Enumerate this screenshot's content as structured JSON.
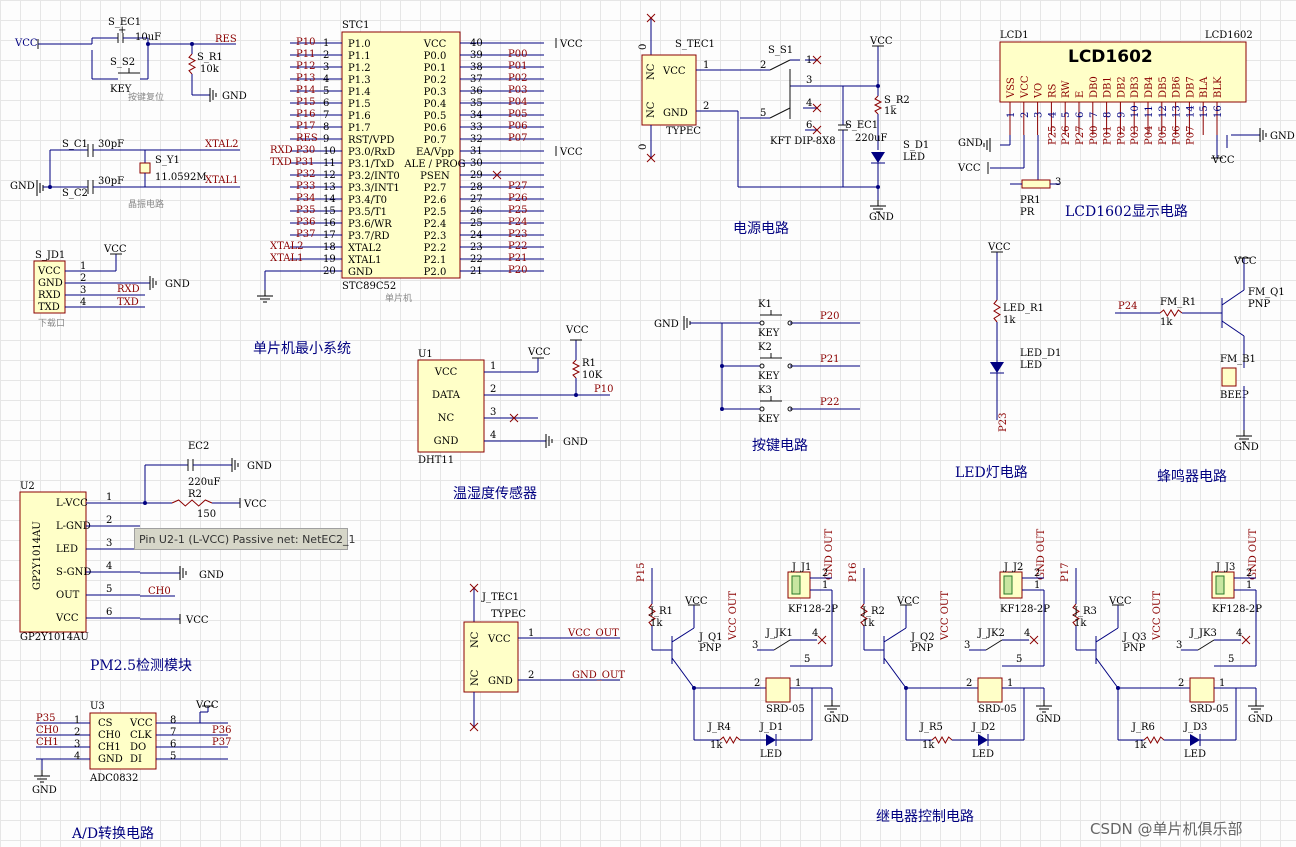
{
  "sections": {
    "mcu_min": "单片机最小系统",
    "power": "电源电路",
    "lcd": "LCD1602显示电路",
    "dht": "温湿度传感器",
    "keys": "按键电路",
    "led": "LED灯电路",
    "buzzer": "蜂鸣器电路",
    "pm25": "PM2.5检测模块",
    "relay": "继电器控制电路",
    "adc": "A/D转换电路"
  },
  "mcu": {
    "ref": "STC1",
    "part": "STC89C52",
    "cn": "单片机",
    "left_pins": [
      {
        "n": "1",
        "name": "P1.0",
        "net": "P10"
      },
      {
        "n": "2",
        "name": "P1.1",
        "net": "P11"
      },
      {
        "n": "3",
        "name": "P1.2",
        "net": "P12"
      },
      {
        "n": "4",
        "name": "P1.3",
        "net": "P13"
      },
      {
        "n": "5",
        "name": "P1.4",
        "net": "P14"
      },
      {
        "n": "6",
        "name": "P1.5",
        "net": "P15"
      },
      {
        "n": "7",
        "name": "P1.6",
        "net": "P16"
      },
      {
        "n": "8",
        "name": "P1.7",
        "net": "P17"
      },
      {
        "n": "9",
        "name": "RST/VPD",
        "net": "RES"
      },
      {
        "n": "10",
        "name": "P3.0/RxD",
        "net": "RXD P30"
      },
      {
        "n": "11",
        "name": "P3.1/TxD",
        "net": "TXD P31"
      },
      {
        "n": "12",
        "name": "P3.2/INT0",
        "net": "P32"
      },
      {
        "n": "13",
        "name": "P3.3/INT1",
        "net": "P33"
      },
      {
        "n": "14",
        "name": "P3.4/T0",
        "net": "P34"
      },
      {
        "n": "15",
        "name": "P3.5/T1",
        "net": "P35"
      },
      {
        "n": "16",
        "name": "P3.6/WR",
        "net": "P36"
      },
      {
        "n": "17",
        "name": "P3.7/RD",
        "net": "P37"
      },
      {
        "n": "18",
        "name": "XTAL2",
        "net": "XTAL2"
      },
      {
        "n": "19",
        "name": "XTAL1",
        "net": "XTAL1"
      },
      {
        "n": "20",
        "name": "GND",
        "net": ""
      }
    ],
    "right_pins": [
      {
        "n": "40",
        "name": "VCC",
        "net": "VCC"
      },
      {
        "n": "39",
        "name": "P0.0",
        "net": "P00"
      },
      {
        "n": "38",
        "name": "P0.1",
        "net": "P01"
      },
      {
        "n": "37",
        "name": "P0.2",
        "net": "P02"
      },
      {
        "n": "36",
        "name": "P0.3",
        "net": "P03"
      },
      {
        "n": "35",
        "name": "P0.4",
        "net": "P04"
      },
      {
        "n": "34",
        "name": "P0.5",
        "net": "P05"
      },
      {
        "n": "33",
        "name": "P0.6",
        "net": "P06"
      },
      {
        "n": "32",
        "name": "P0.7",
        "net": "P07"
      },
      {
        "n": "31",
        "name": "EA/Vpp",
        "net": "VCC"
      },
      {
        "n": "30",
        "name": "ALE / PROG",
        "net": ""
      },
      {
        "n": "29",
        "name": "PSEN",
        "net": ""
      },
      {
        "n": "28",
        "name": "P2.7",
        "net": "P27"
      },
      {
        "n": "27",
        "name": "P2.6",
        "net": "P26"
      },
      {
        "n": "26",
        "name": "P2.5",
        "net": "P25"
      },
      {
        "n": "25",
        "name": "P2.4",
        "net": "P24"
      },
      {
        "n": "24",
        "name": "P2.3",
        "net": "P23"
      },
      {
        "n": "23",
        "name": "P2.2",
        "net": "P22"
      },
      {
        "n": "22",
        "name": "P2.1",
        "net": "P21"
      },
      {
        "n": "21",
        "name": "P2.0",
        "net": "P20"
      }
    ]
  },
  "reset": {
    "ec": "S_EC1",
    "ec_val": "10uF",
    "sw": "S_S2",
    "sw_val": "KEY",
    "r": "S_R1",
    "r_val": "10k",
    "net_res": "RES",
    "cap": "按键复位",
    "vcc": "VCC",
    "gnd": "GND"
  },
  "crystal": {
    "c1": "S_C1",
    "c2": "S_C2",
    "cval": "30pF",
    "y": "S_Y1",
    "yval": "11.0592M",
    "x2": "XTAL2",
    "x1": "XTAL1",
    "gnd": "GND",
    "cap": "晶振电路"
  },
  "download": {
    "ref": "S_JD1",
    "pins": [
      "VCC",
      "GND",
      "RXD",
      "TXD"
    ],
    "nums": [
      "1",
      "2",
      "3",
      "4"
    ],
    "vcc": "VCC",
    "gnd": "GND",
    "rxd": "RXD",
    "txd": "TXD",
    "cap": "下载口"
  },
  "power": {
    "ref": "S_TEC1",
    "part": "TYPEC",
    "nc": "NC",
    "vcc": "VCC",
    "gnd": "GND",
    "sw": "S_S1",
    "swpart": "KFT DIP-8X8",
    "ec": "S_EC1",
    "ecval": "220uF",
    "r": "S_R2",
    "rval": "1k",
    "led": "S_D1",
    "ledv": "LED",
    "gndn": "GND",
    "vccn": "VCC",
    "p1": "1",
    "p2": "2",
    "zero": "0",
    "s": [
      "1",
      "2",
      "3",
      "4",
      "5",
      "6"
    ]
  },
  "lcd": {
    "ref": "LCD1",
    "part": "LCD1602",
    "title": "LCD1602",
    "pins": [
      "VSS",
      "VCC",
      "VO",
      "RS",
      "RW",
      "E",
      "DB0",
      "DB1",
      "DB2",
      "DB3",
      "DB4",
      "DB5",
      "DB6",
      "DB7",
      "BLA",
      "BLK"
    ],
    "nums": [
      "1",
      "2",
      "3",
      "4",
      "5",
      "6",
      "7",
      "8",
      "9",
      "10",
      "11",
      "12",
      "13",
      "14",
      "15",
      "16"
    ],
    "nets": [
      "",
      "",
      "",
      "P25",
      "P26",
      "P27",
      "P00",
      "P01",
      "P02",
      "P03",
      "P04",
      "P05",
      "P06",
      "P07",
      "",
      ""
    ],
    "pr": "PR1",
    "prv": "PR",
    "gnd": "GND",
    "vcc": "VCC",
    "p3": "3"
  },
  "dht": {
    "ref": "U1",
    "part": "DHT11",
    "pins": [
      "VCC",
      "DATA",
      "NC",
      "GND"
    ],
    "nums": [
      "1",
      "2",
      "3",
      "4"
    ],
    "r": "R1",
    "rval": "10K",
    "net": "P10",
    "vcc": "VCC",
    "gnd": "GND"
  },
  "keys": {
    "gnd": "GND",
    "items": [
      {
        "ref": "K1",
        "val": "KEY",
        "net": "P20"
      },
      {
        "ref": "K2",
        "val": "KEY",
        "net": "P21"
      },
      {
        "ref": "K3",
        "val": "KEY",
        "net": "P22"
      }
    ]
  },
  "led": {
    "vcc": "VCC",
    "r": "LED_R1",
    "rval": "1k",
    "d": "LED_D1",
    "dv": "LED",
    "net": "P23"
  },
  "buzzer": {
    "vcc": "VCC",
    "net": "P24",
    "r": "FM_R1",
    "rval": "1k",
    "q": "FM_Q1",
    "qv": "PNP",
    "b": "FM_B1",
    "bv": "BEEP",
    "gnd": "GND"
  },
  "pm25": {
    "ref": "U2",
    "part": "GP2Y1014AU",
    "pins": [
      "L-VCC",
      "L-GND",
      "LED",
      "S-GND",
      "OUT",
      "VCC"
    ],
    "nums": [
      "1",
      "2",
      "3",
      "4",
      "5",
      "6"
    ],
    "ec": "EC2",
    "ecv": "220uF",
    "r": "R2",
    "rv": "150",
    "vcc": "VCC",
    "gnd": "GND",
    "out": "CH0"
  },
  "tooltip": "Pin U2-1 (L-VCC) Passive    net: NetEC2_1",
  "typec2": {
    "ref": "J_TEC1",
    "part": "TYPEC",
    "vcc": "VCC",
    "gnd": "GND",
    "nc": "NC",
    "out1": "VCC_OUT",
    "out2": "GND_OUT",
    "p1": "1",
    "p2": "2",
    "zero": "0"
  },
  "relays": [
    {
      "net": "P15",
      "r": "J_R1",
      "q": "J_Q1",
      "j": "J_J1",
      "jk": "J_JK1",
      "r4": "J_R4",
      "d": "J_D1"
    },
    {
      "net": "P16",
      "r": "J_R2",
      "q": "J_Q2",
      "j": "J_J2",
      "jk": "J_JK2",
      "r4": "J_R5",
      "d": "J_D2"
    },
    {
      "net": "P17",
      "r": "J_R3",
      "q": "J_Q3",
      "j": "J_J3",
      "jk": "J_JK3",
      "r4": "J_R6",
      "d": "J_D3"
    }
  ],
  "relay_common": {
    "rval": "1k",
    "qv": "PNP",
    "vcc": "VCC",
    "vcc_out": "VCC OUT",
    "gnd_out": "GND OUT",
    "kf": "KF128-2P",
    "srd": "SRD-05",
    "led": "LED",
    "gnd": "GND"
  },
  "adc": {
    "ref": "U3",
    "part": "ADC0832",
    "lpins": [
      "CS",
      "CH0",
      "CH1",
      "GND"
    ],
    "rpins": [
      "VCC",
      "CLK",
      "DO",
      "DI"
    ],
    "lnums": [
      "1",
      "2",
      "3",
      "4"
    ],
    "rnums": [
      "8",
      "7",
      "6",
      "5"
    ],
    "lnets": [
      "P35",
      "CH0",
      "CH1",
      ""
    ],
    "rnets": [
      "",
      "P36",
      "P37",
      ""
    ],
    "vcc": "VCC",
    "gnd": "GND"
  },
  "watermark": "CSDN @单片机俱乐部"
}
